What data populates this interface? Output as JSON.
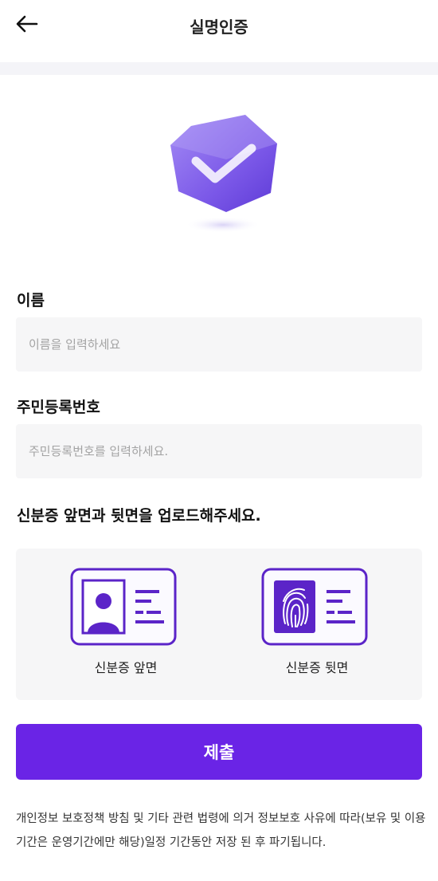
{
  "header": {
    "title": "실명인증"
  },
  "form": {
    "name_label": "이름",
    "name_placeholder": "이름을 입력하세요",
    "rrn_label": "주민등록번호",
    "rrn_placeholder": "주민등록번호를 입력하세요.",
    "upload_label": "신분증 앞면과 뒷면을 업로드해주세요.",
    "front_label": "신분증 앞면",
    "back_label": "신분증 뒷면"
  },
  "actions": {
    "submit_label": "제출"
  },
  "notice": {
    "text": "개인정보 보호정책 방침 및 기타 관련 법령에 의거 정보보호 사유에 따라(보유 및 이용기간은 운영기간에만 해당)일정 기간동안 저장 된 후 파기됩니다."
  },
  "colors": {
    "accent": "#6a24e6",
    "icon_purple": "#5b24c8",
    "field_bg": "#f6f6f7"
  },
  "icons": {
    "back": "arrow-left-icon",
    "hero": "shield-check-icon",
    "front": "id-card-person-icon",
    "back_card": "id-card-fingerprint-icon"
  }
}
